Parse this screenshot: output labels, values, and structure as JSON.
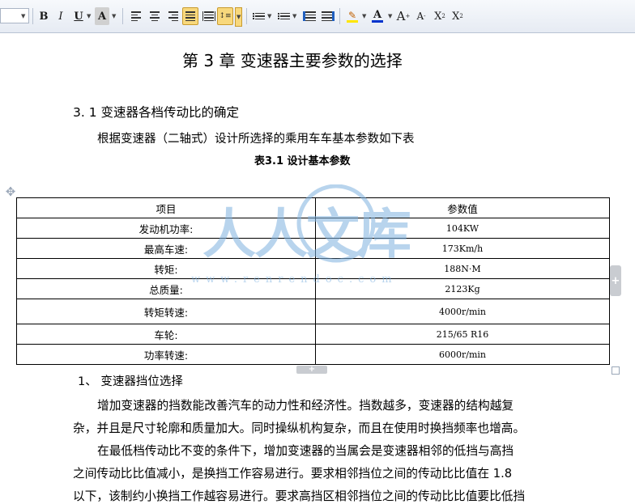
{
  "toolbar": {
    "bold": "B",
    "italic": "I",
    "underline": "U",
    "char_shade": "A",
    "font_color": "A",
    "grow": "A",
    "shrink": "A",
    "superscript": "X",
    "subscript": "X",
    "sup_mark": "2",
    "sub_mark": "2",
    "plus_mark": "+",
    "minus_mark": "-"
  },
  "document": {
    "chapter_title": "第 3 章  变速器主要参数的选择",
    "section_heading": "3. 1 变速器各档传动比的确定",
    "intro": "根据变速器（二轴式）设计所选择的乘用车车基本参数如下表",
    "table_caption": "表3.1 设计基本参数",
    "table": {
      "headers": [
        "项目",
        "参数值"
      ],
      "rows": [
        [
          "发动机功率:",
          "104KW"
        ],
        [
          "最高车速:",
          "173Km/h"
        ],
        [
          "转矩:",
          "188N·M"
        ],
        [
          "总质量:",
          "2123Kg"
        ],
        [
          "转矩转速:",
          "4000r/min"
        ],
        [
          "车轮:",
          "215/65 R16"
        ],
        [
          "功率转速:",
          "6000r/min"
        ]
      ]
    },
    "list_heading": "1、 变速器挡位选择",
    "paragraph1_line1": "增加变速器的挡数能改善汽车的动力性和经济性。挡数越多，变速器的结构越复",
    "paragraph1_line2": "杂，并且是尺寸轮廓和质量加大。同时操纵机构复杂，而且在使用时换挡频率也增高。",
    "paragraph2_line1": "在最低档传动比不变的条件下，增加变速器的当属会是变速器相邻的低挡与高挡",
    "paragraph2_line2": "之间传动比比值减小，是换挡工作容易进行。要求相邻挡位之间的传动比比值在 1.8",
    "paragraph2_line3": "以下，该制约小换挡工作越容易进行。要求高挡区相邻挡位之间的传动比比值要比低挡"
  },
  "watermark": {
    "logo_text": "人人文库",
    "url": "www.renrendoc.com"
  },
  "colors": {
    "accent_highlight": "#f8d87c",
    "highlighter_yellow": "#ffe600",
    "font_color_blue": "#0033cc",
    "watermark_blue": "#7fb2e0"
  }
}
